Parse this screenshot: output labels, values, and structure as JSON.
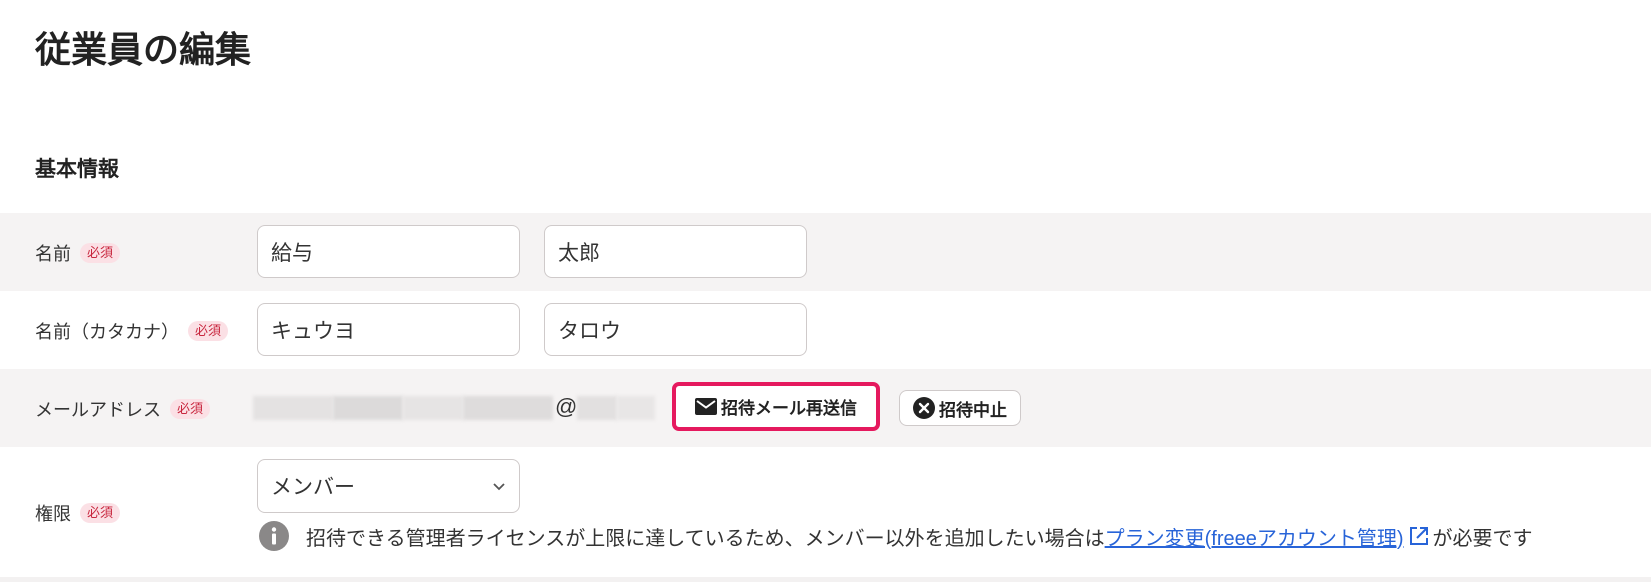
{
  "page_title": "従業員の編集",
  "section_title": "基本情報",
  "required_badge": "必須",
  "form": {
    "name": {
      "label": "名前",
      "last_name": "給与",
      "first_name": "太郎"
    },
    "name_kana": {
      "label": "名前（カタカナ）",
      "last_name": "キュウヨ",
      "first_name": "タロウ"
    },
    "email": {
      "label": "メールアドレス",
      "at_sign": "@",
      "resend_button": "招待メール再送信",
      "cancel_button": "招待中止"
    },
    "role": {
      "label": "権限",
      "selected": "メンバー",
      "notice": {
        "before": "招待できる管理者ライセンスが上限に達しているため、メンバー以外を追加したい場合は",
        "link": "プラン変更(freeeアカウント管理)",
        "after": "が必要です"
      }
    }
  },
  "icons": {
    "resend": "mail-icon",
    "cancel": "close-circle-icon",
    "select": "chevron-down-icon",
    "notice": "info-icon",
    "link": "external-link-icon"
  },
  "colors": {
    "row_shade": "#f5f3f3",
    "badge_bg": "#fbe0e5",
    "badge_text": "#c8263e",
    "highlight": "#e5195e",
    "link": "#2864d8"
  }
}
